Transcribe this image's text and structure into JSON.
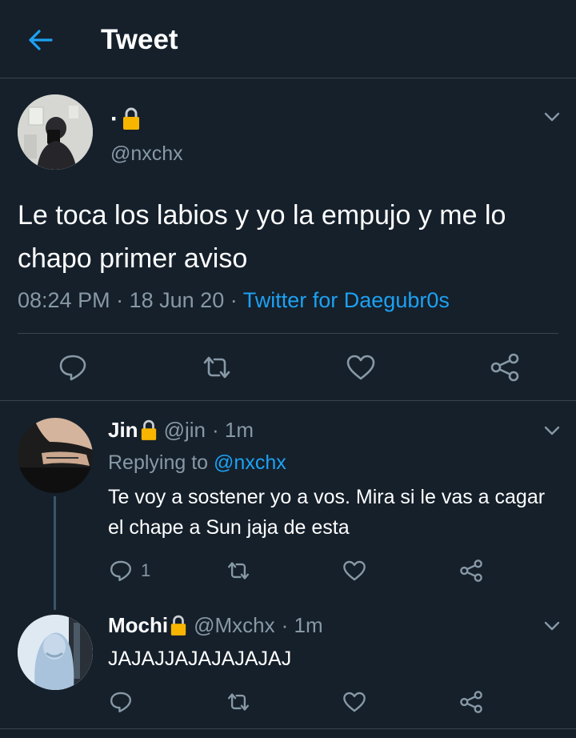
{
  "header": {
    "title": "Tweet"
  },
  "main_tweet": {
    "name": "·",
    "handle": "@nxchx",
    "text": "Le toca los labios y yo la empujo y me lo chapo primer aviso",
    "time": "08:24 PM",
    "sep1": "·",
    "date": "18 Jun 20",
    "sep2": "·",
    "source": "Twitter for Daegubr0s"
  },
  "replies": [
    {
      "name": "Jin",
      "handle": "@jin",
      "time": "· 1m",
      "replying_label": "Replying to",
      "replying_to": "@nxchx",
      "text": "Te voy a sostener yo a vos. Mira si le vas a cagar el chape a Sun jaja de esta",
      "reply_count": "1"
    },
    {
      "name": "Mochi",
      "handle": "@Mxchx",
      "time": "· 1m",
      "text": "JAJAJJAJAJAJAJAJ"
    }
  ],
  "colors": {
    "background": "#15202b",
    "accent": "#1da1f2",
    "secondary_text": "#8899a6",
    "divider": "#38444d",
    "lock": "#f7b500"
  },
  "icons": [
    "back-arrow-icon",
    "lock-icon",
    "chevron-down-icon",
    "reply-icon",
    "retweet-icon",
    "like-icon",
    "share-icon"
  ]
}
